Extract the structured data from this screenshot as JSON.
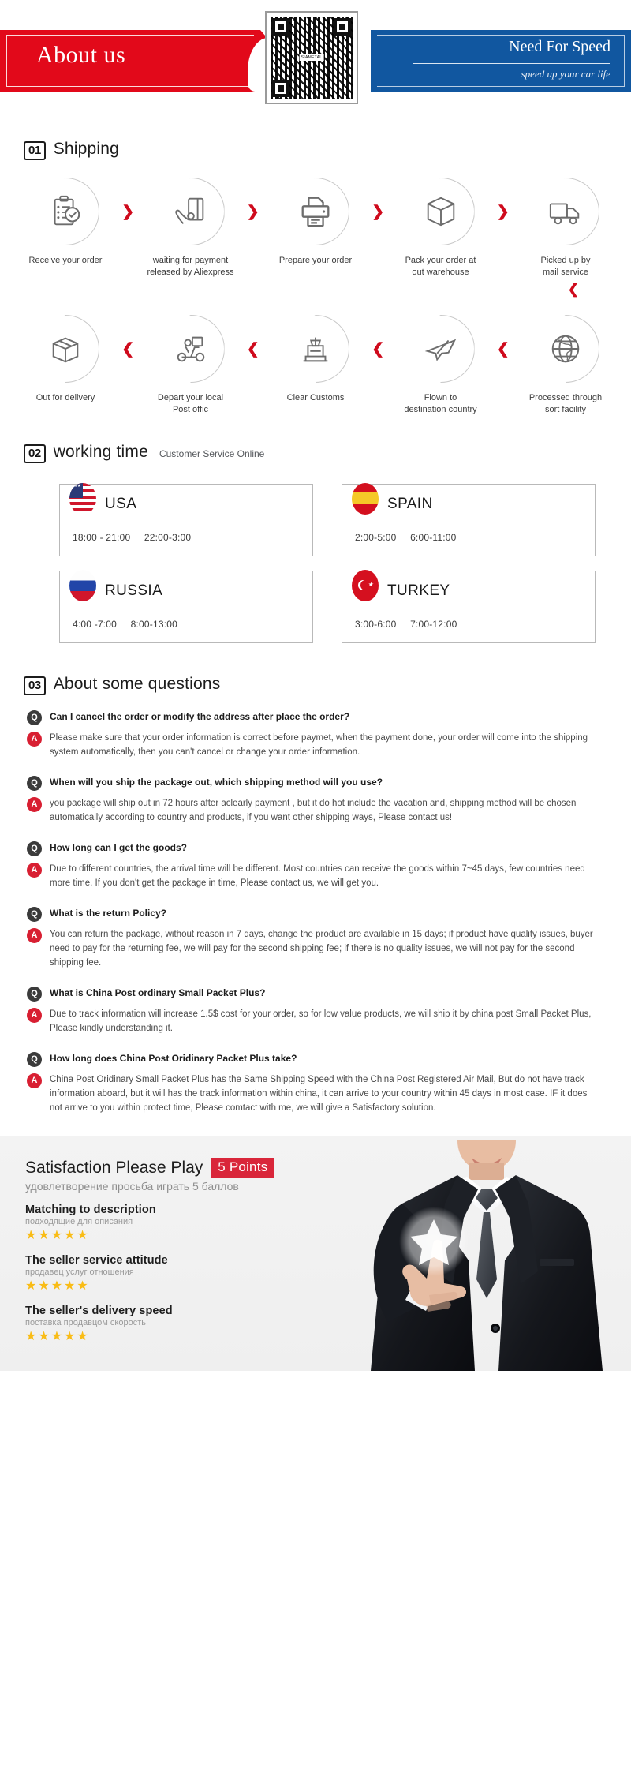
{
  "header": {
    "left_title": "About us",
    "right_title": "Need For Speed",
    "right_tagline": "speed up your car life",
    "qr_label": "SIAMETAL"
  },
  "shipping": {
    "num": "01",
    "title": "Shipping",
    "chevron_right": "❯",
    "chevron_left": "❮",
    "chevron_down": "❯",
    "row1": [
      {
        "icon": "clipboard-check-icon",
        "label": "Receive your order"
      },
      {
        "icon": "hand-card-icon",
        "label": "waiting for payment\nreleased by Aliexpress"
      },
      {
        "icon": "printer-icon",
        "label": "Prepare your order"
      },
      {
        "icon": "box-icon",
        "label": "Pack your order at\nout warehouse"
      },
      {
        "icon": "truck-icon",
        "label": "Picked up by\nmail service"
      }
    ],
    "row2": [
      {
        "icon": "open-box-icon",
        "label": "Out  for delivery"
      },
      {
        "icon": "scooter-delivery-icon",
        "label": "Depart your local\nPost offic"
      },
      {
        "icon": "customs-stamp-icon",
        "label": "Clear Customs"
      },
      {
        "icon": "airplane-icon",
        "label": "Flown to\ndestination country"
      },
      {
        "icon": "globe-icon",
        "label": "Processed through\nsort facility"
      }
    ]
  },
  "worktime": {
    "num": "02",
    "title": "working time",
    "subtitle": "Customer Service Online",
    "cards": [
      {
        "flag": "usa-flag-icon",
        "country": "USA",
        "hours": [
          "18:00 - 21:00",
          "22:00-3:00"
        ]
      },
      {
        "flag": "spain-flag-icon",
        "country": "SPAIN",
        "hours": [
          "2:00-5:00",
          "6:00-11:00"
        ]
      },
      {
        "flag": "russia-flag-icon",
        "country": "RUSSIA",
        "hours": [
          "4:00 -7:00",
          "8:00-13:00"
        ]
      },
      {
        "flag": "turkey-flag-icon",
        "country": "TURKEY",
        "hours": [
          "3:00-6:00",
          "7:00-12:00"
        ]
      }
    ]
  },
  "faq": {
    "num": "03",
    "title": "About some questions",
    "q_badge": "Q",
    "a_badge": "A",
    "items": [
      {
        "question": "Can I cancel the order or modify the address after place the order?",
        "answer": "Please make sure that your order information is correct before paymet, when the payment done, your order will come into the shipping system automatically, then you can't cancel or change your order information."
      },
      {
        "question": "When will you ship the package out, which shipping method will you use?",
        "answer": "you package will ship out in 72 hours after aclearly payment , but it do hot include the vacation and, shipping method will be chosen automatically according to country and products, if you want other shipping ways, Please contact us!"
      },
      {
        "question": "How long can I get the goods?",
        "answer": "Due to different countries, the arrival time will be different. Most countries can receive the goods within 7~45 days, few countries need more time. If you don't get the package in time, Please contact us, we will get you."
      },
      {
        "question": "What is the return Policy?",
        "answer": "You can return the package, without reason in 7 days, change the product are available in 15 days; if product have quality issues, buyer need to pay for the returning fee, we will pay for the second shipping fee; if there is no quality issues, we will not pay for the second shipping fee."
      },
      {
        "question": "What is China Post ordinary Small Packet Plus?",
        "answer": "Due to track information will increase 1.5$ cost for your order, so for low value products, we will ship it by china post Small Packet Plus, Please kindly understanding it."
      },
      {
        "question": "How long does China Post Oridinary Packet Plus take?",
        "answer": "China Post Oridinary Small Packet Plus has the Same Shipping Speed with the China Post Registered Air Mail, But do not have track information aboard, but it will has the track information within china, it can arrive to your country within 45 days in most case. IF it does not arrive to you within protect time, Please comtact with me, we will give a Satisfactory solution."
      }
    ]
  },
  "satisfaction": {
    "title": "Satisfaction Please Play",
    "points_badge": "5 Points",
    "subtitle": "удовлетворение просьба играть 5 баллов",
    "ratings": [
      {
        "en": "Matching to description",
        "ru": "подходящие для описания",
        "stars": "★★★★★"
      },
      {
        "en": "The seller service attitude",
        "ru": "продавец услуг отношения",
        "stars": "★★★★★"
      },
      {
        "en": "The seller's delivery speed",
        "ru": "поставка продавцом скорость",
        "stars": "★★★★★"
      }
    ]
  },
  "colors": {
    "red": "#e2091a",
    "blue": "#1157a0",
    "accent_red": "#d81f32",
    "star_yellow": "#f9bc15"
  }
}
